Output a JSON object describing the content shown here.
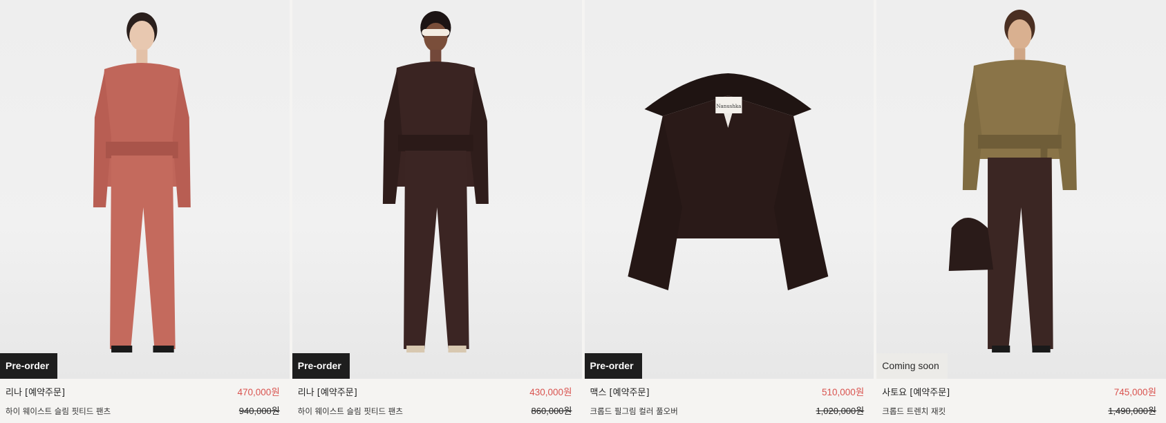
{
  "products": [
    {
      "badge": "Pre-order",
      "name": "리나 [예약주문]",
      "description": "하이 웨이스트 슬림 핏티드 팬츠",
      "price": "470,000원",
      "original_price": "940,000원"
    },
    {
      "badge": "Pre-order",
      "name": "리나 [예약주문]",
      "description": "하이 웨이스트 슬림 핏티드 팬츠",
      "price": "430,000원",
      "original_price": "860,000원"
    },
    {
      "badge": "Pre-order",
      "name": "맥스 [예약주문]",
      "description": "크롭드 필그림 컬러 풀오버",
      "price": "510,000원",
      "original_price": "1,020,000원",
      "label_text": "Nanushka"
    },
    {
      "badge": "Coming soon",
      "name": "사토요 [예약주문]",
      "description": "크롭드 트렌치 재킷",
      "price": "745,000원",
      "original_price": "1,490,000원"
    }
  ],
  "colors": {
    "sale": "#d9534f",
    "badge_dark": "#1e1e1e",
    "badge_light": "#ecebe8",
    "background": "#f5f4f2"
  }
}
